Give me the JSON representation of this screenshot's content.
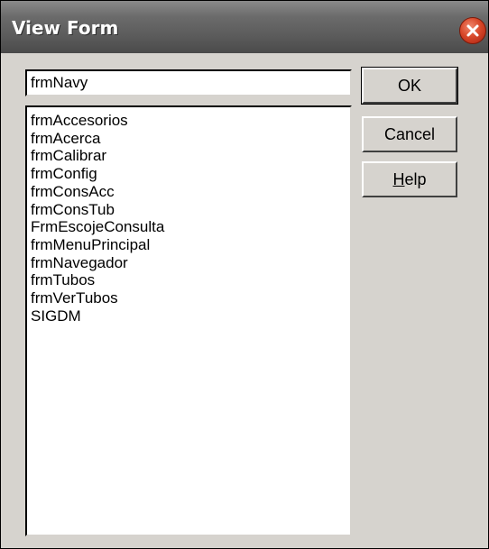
{
  "window": {
    "title": "View Form"
  },
  "form_name_input": {
    "value": "frmNavy"
  },
  "form_list": {
    "items": [
      "frmAccesorios",
      "frmAcerca",
      "frmCalibrar",
      "frmConfig",
      "frmConsAcc",
      "frmConsTub",
      "FrmEscojeConsulta",
      "frmMenuPrincipal",
      "frmNavegador",
      "frmTubos",
      "frmVerTubos",
      "SIGDM"
    ]
  },
  "buttons": {
    "ok_label": "OK",
    "cancel_label": "Cancel",
    "help_label_mnemonic": "H",
    "help_label_rest": "elp"
  },
  "icons": {
    "close": "close-icon"
  },
  "colors": {
    "close_button": "#d8482a",
    "titlebar": "#6b6b6b",
    "dialog_face": "#d6d3ce"
  }
}
